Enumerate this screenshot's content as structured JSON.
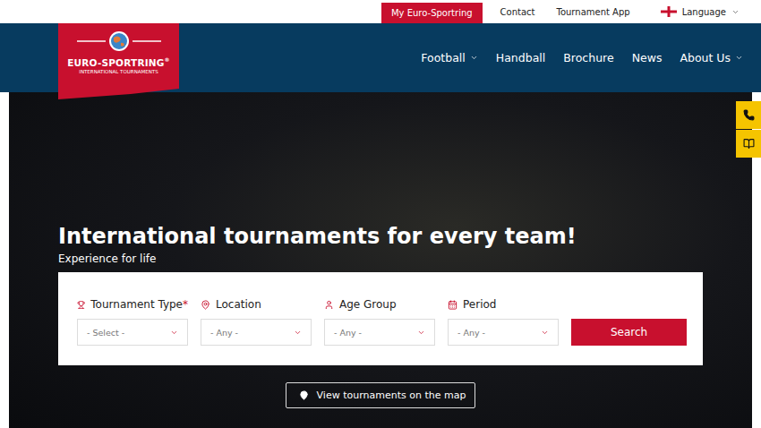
{
  "topbar": {
    "account_button": "My Euro-Sportring",
    "links": [
      "Contact",
      "Tournament App"
    ],
    "language": "Language"
  },
  "logo": {
    "name": "EURO-SPORTRING",
    "mark": "®",
    "tagline": "INTERNATIONAL TOURNAMENTS"
  },
  "nav": [
    {
      "label": "Football",
      "has_menu": true
    },
    {
      "label": "Handball",
      "has_menu": false
    },
    {
      "label": "Brochure",
      "has_menu": false
    },
    {
      "label": "News",
      "has_menu": false
    },
    {
      "label": "About Us",
      "has_menu": true
    }
  ],
  "hero": {
    "title": "International tournaments for every team!",
    "subtitle": "Experience for life"
  },
  "search": {
    "required_mark": "*",
    "fields": [
      {
        "kind": "type",
        "label": "Tournament Type",
        "required": true,
        "value": "- Select -"
      },
      {
        "kind": "location",
        "label": "Location",
        "required": false,
        "value": "- Any -"
      },
      {
        "kind": "age",
        "label": "Age Group",
        "required": false,
        "value": "- Any -"
      },
      {
        "kind": "period",
        "label": "Period",
        "required": false,
        "value": "- Any -"
      }
    ],
    "button": "Search"
  },
  "map_button": "View tournaments on the map"
}
